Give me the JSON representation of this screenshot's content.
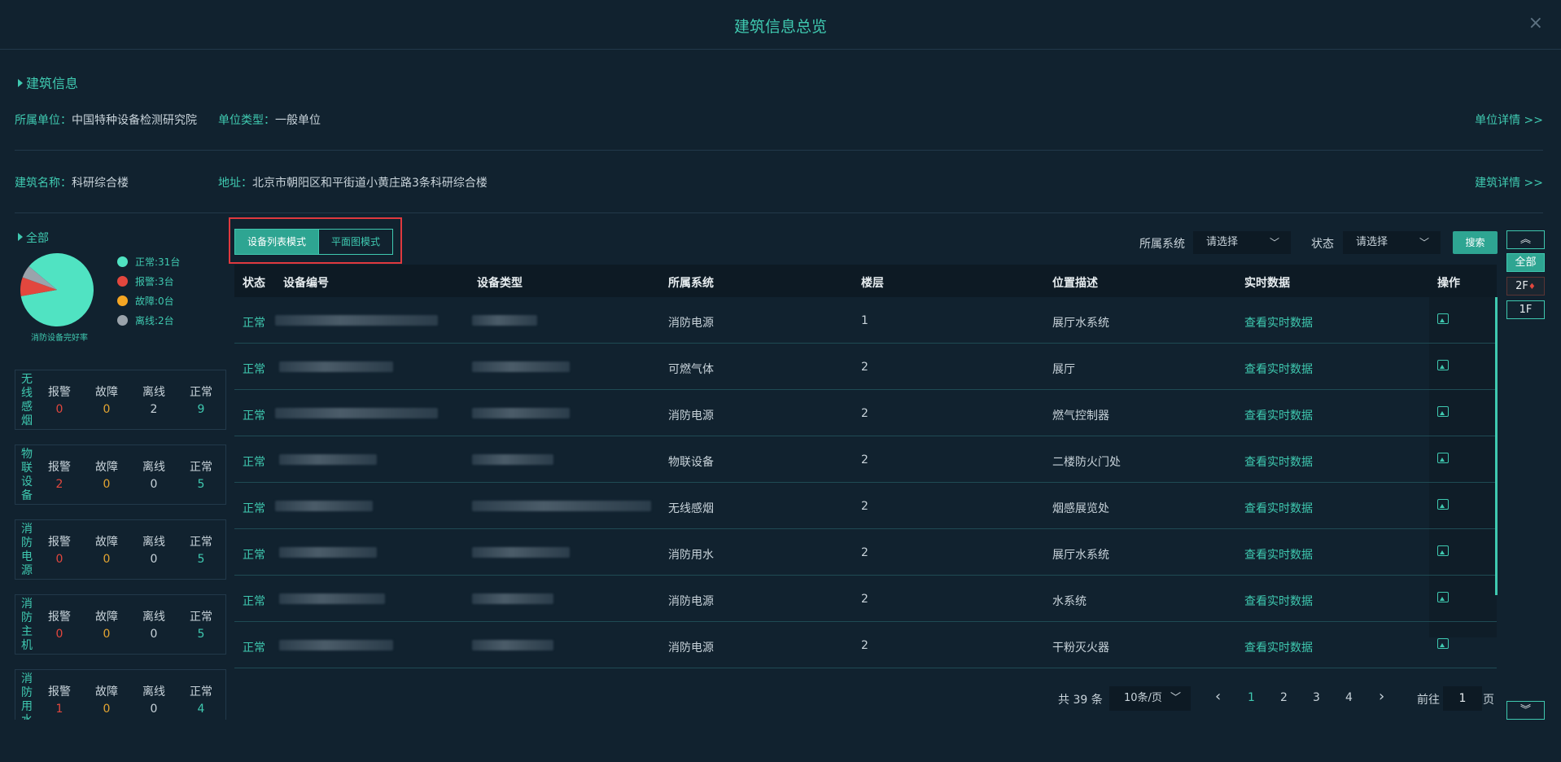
{
  "window": {
    "title": "建筑信息总览",
    "close_icon": "×"
  },
  "building_info": {
    "section_title": "建筑信息",
    "unit_label": "所属单位：",
    "unit_value": "中国特种设备检测研究院",
    "type_label": "单位类型：",
    "type_value": "一般单位",
    "unit_detail_link": "单位详情 >>",
    "name_label": "建筑名称：",
    "name_value": "科研综合楼",
    "address_label": "地址：",
    "address_value": "北京市朝阳区和平街道小黄庄路3条科研综合楼",
    "building_detail_link": "建筑详情 >>"
  },
  "summary": {
    "all_label": "全部",
    "pie_caption": "消防设备完好率",
    "legend": [
      {
        "label": "正常:31台",
        "color": "#50e3c2",
        "count": 31
      },
      {
        "label": "报警:3台",
        "color": "#e2473e",
        "count": 3
      },
      {
        "label": "故障:0台",
        "color": "#f5a623",
        "count": 0
      },
      {
        "label": "离线:2台",
        "color": "#9aa3ab",
        "count": 2
      }
    ],
    "col_headers": [
      "报警",
      "故障",
      "离线",
      "正常"
    ],
    "categories": [
      {
        "name": "无线感烟",
        "values": [
          "0",
          "0",
          "2",
          "9"
        ]
      },
      {
        "name": "物联设备",
        "values": [
          "2",
          "0",
          "0",
          "5"
        ]
      },
      {
        "name": "消防电源",
        "values": [
          "0",
          "0",
          "0",
          "5"
        ]
      },
      {
        "name": "消防主机",
        "values": [
          "0",
          "0",
          "0",
          "5"
        ]
      },
      {
        "name": "消防用水",
        "values": [
          "1",
          "0",
          "0",
          "4"
        ]
      }
    ]
  },
  "modes": {
    "list": "设备列表模式",
    "plan": "平面图模式"
  },
  "filters": {
    "system_label": "所属系统",
    "system_placeholder": "请选择",
    "status_label": "状态",
    "status_placeholder": "请选择",
    "search_button": "搜索"
  },
  "table": {
    "headers": [
      "状态",
      "设备编号",
      "设备类型",
      "所属系统",
      "楼层",
      "位置描述",
      "实时数据",
      "操作"
    ],
    "rows": [
      {
        "status": "正常",
        "system": "消防电源",
        "floor": "1",
        "location": "展厅水系统",
        "realtime": "查看实时数据"
      },
      {
        "status": "正常",
        "system": "可燃气体",
        "floor": "2",
        "location": "展厅",
        "realtime": "查看实时数据"
      },
      {
        "status": "正常",
        "system": "消防电源",
        "floor": "2",
        "location": "燃气控制器",
        "realtime": "查看实时数据"
      },
      {
        "status": "正常",
        "system": "物联设备",
        "floor": "2",
        "location": "二楼防火门处",
        "realtime": "查看实时数据"
      },
      {
        "status": "正常",
        "system": "无线感烟",
        "floor": "2",
        "location": "烟感展览处",
        "realtime": "查看实时数据"
      },
      {
        "status": "正常",
        "system": "消防用水",
        "floor": "2",
        "location": "展厅水系统",
        "realtime": "查看实时数据"
      },
      {
        "status": "正常",
        "system": "消防电源",
        "floor": "2",
        "location": "水系统",
        "realtime": "查看实时数据"
      },
      {
        "status": "正常",
        "system": "消防电源",
        "floor": "2",
        "location": "干粉灭火器",
        "realtime": "查看实时数据"
      }
    ]
  },
  "pagination": {
    "total": "共 39 条",
    "page_size": "10条/页",
    "pages": [
      "1",
      "2",
      "3",
      "4"
    ],
    "current": "1",
    "prev": "‹",
    "next": "›",
    "goto_label": "前往",
    "goto_value": "1",
    "page_suffix": "页"
  },
  "floor_nav": {
    "up": "︽",
    "all": "全部",
    "f2": "2F",
    "f1": "1F",
    "down": "︾"
  },
  "colors": {
    "accent": "#3fc9b0",
    "background": "#11222f",
    "alarm": "#e2473e",
    "fault": "#e4a531",
    "highlight_border": "#e0393e"
  }
}
